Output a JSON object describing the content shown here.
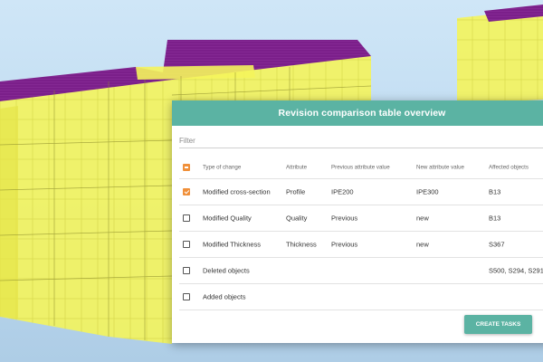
{
  "dialog": {
    "title": "Revision comparison table overview",
    "filter_placeholder": "Filter",
    "create_button_label": "CREATE TASKS"
  },
  "table": {
    "headers": [
      "Type of change",
      "Attribute",
      "Previous attribute value",
      "New attribute value",
      "Affected objects"
    ],
    "select_all_state": "indeterminate",
    "rows": [
      {
        "checked": true,
        "type": "Modified cross-section",
        "attribute": "Profile",
        "previous": "IPE200",
        "new": "IPE300",
        "affected": "B13"
      },
      {
        "checked": false,
        "type": "Modified Quality",
        "attribute": "Quality",
        "previous": "Previous",
        "new": "new",
        "affected": "B13"
      },
      {
        "checked": false,
        "type": "Modified Thickness",
        "attribute": "Thickness",
        "previous": "Previous",
        "new": "new",
        "affected": "S367"
      },
      {
        "checked": false,
        "type": "Deleted objects",
        "attribute": "",
        "previous": "",
        "new": "",
        "affected": "S500, S294, S291"
      },
      {
        "checked": false,
        "type": "Added objects",
        "attribute": "",
        "previous": "",
        "new": "",
        "affected": ""
      }
    ]
  },
  "colors": {
    "accent": "#5bb3a3",
    "checkbox": "#f0903a",
    "model_yellow": "#f5f55a",
    "model_roof": "#7b1f8a"
  }
}
